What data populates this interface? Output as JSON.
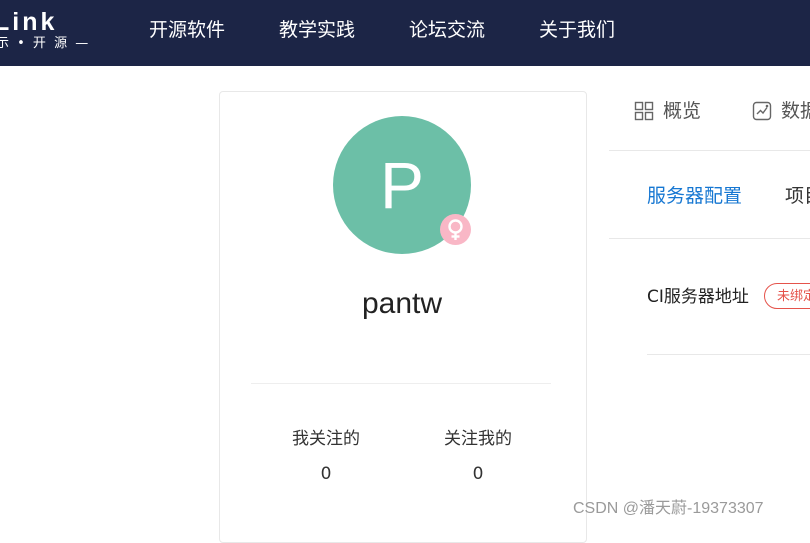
{
  "header": {
    "logo_text": "Link",
    "logo_sub": "示 • 开 源 —",
    "nav": [
      "开源软件",
      "教学实践",
      "论坛交流",
      "关于我们"
    ]
  },
  "profile": {
    "avatar_letter": "P",
    "username": "pantw",
    "gender_icon": "female-icon",
    "following_label": "我关注的",
    "following_count": "0",
    "followers_label": "关注我的",
    "followers_count": "0"
  },
  "right_panel": {
    "tabs": [
      {
        "label": "概览",
        "icon": "grid-icon"
      },
      {
        "label": "数据",
        "icon": "chart-icon"
      }
    ],
    "subtabs": [
      "服务器配置",
      "项目"
    ],
    "active_subtab_color": "#1677d2",
    "ci_label": "CI服务器地址",
    "ci_status": "未绑定"
  },
  "colors": {
    "header_bg": "#1c2546",
    "avatar_bg": "#6cbfa7",
    "gender_bg": "#f9b7c6",
    "badge": "#e5534b"
  },
  "watermark": "CSDN @潘天蔚-19373307"
}
